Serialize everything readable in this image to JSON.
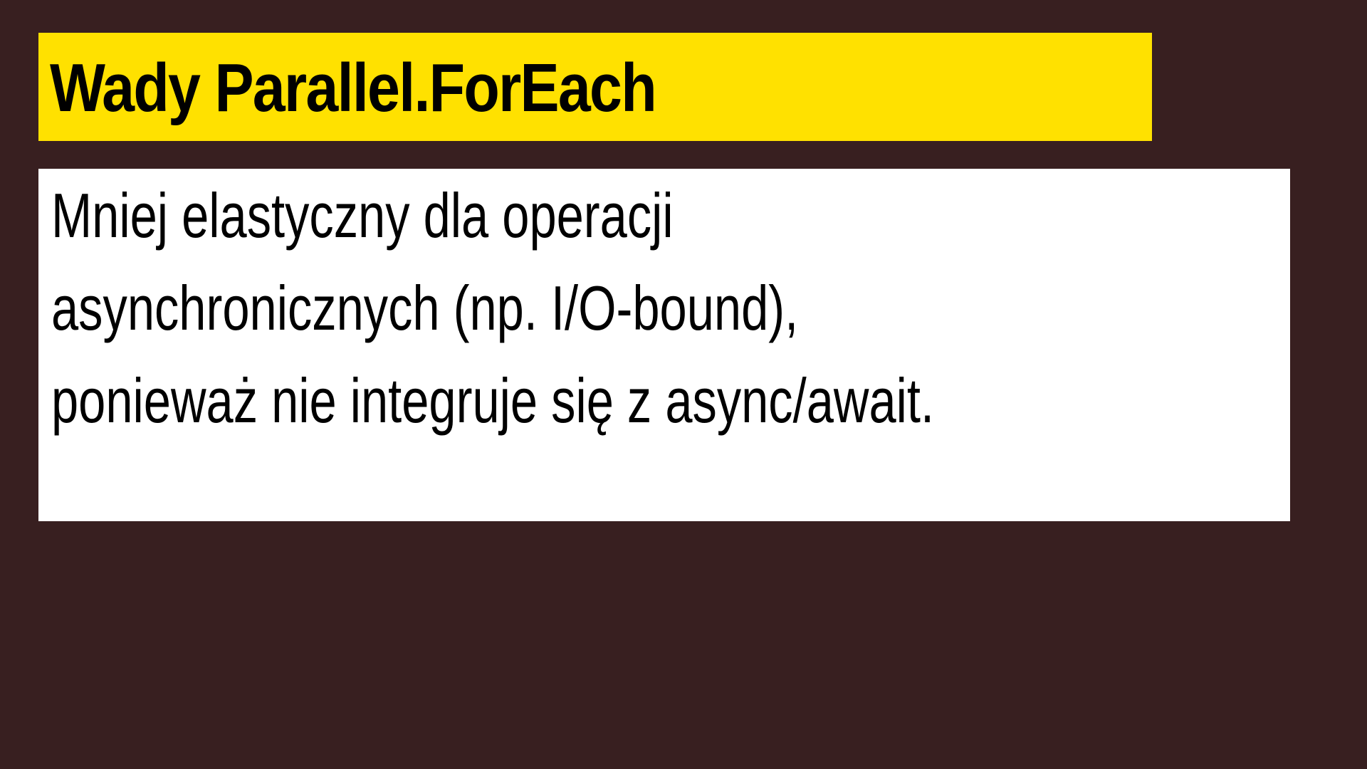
{
  "slide": {
    "title": "Wady Parallel.ForEach",
    "body_lines": [
      "Mniej elastyczny dla operacji",
      "asynchronicznych (np. I/O-bound),",
      "ponieważ nie integruje się z async/await."
    ],
    "colors": {
      "background": "#381f20",
      "title_background": "#ffe100",
      "body_background": "#ffffff",
      "text": "#000000"
    }
  }
}
